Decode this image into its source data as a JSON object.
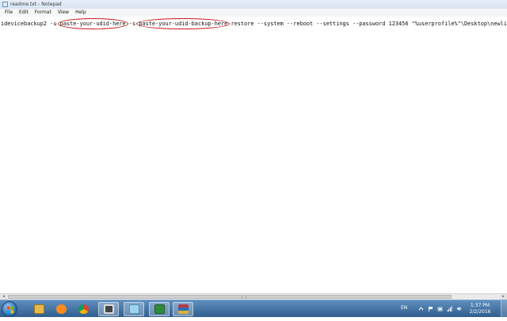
{
  "window": {
    "title": "readme.txt - Notepad"
  },
  "menu": {
    "items": [
      "File",
      "Edit",
      "Format",
      "View",
      "Help"
    ]
  },
  "editor": {
    "seg1": "idevicebackup2 -u ",
    "udid_placeholder": "paste-your-udid-here",
    "seg2": " -s ",
    "backup_placeholder": "paste-your-udid-backup-here",
    "seg3": " restore --system --reboot --settings --password 123456 \"%userprofile%\"\\Desktop\\newlibim"
  },
  "annotation_color": "#c4161c",
  "taskbar": {
    "language": "EN",
    "time": "1:37 PM",
    "date": "2/2/2016",
    "pinned": [
      {
        "name": "explorer-icon",
        "color": "#e8b84a"
      },
      {
        "name": "media-player-icon",
        "color": "#ff8a1c"
      },
      {
        "name": "chrome-icon",
        "color": "#4caf50"
      },
      {
        "name": "camera-icon",
        "color": "#444444"
      },
      {
        "name": "notepad-icon",
        "color": "#9fd3f0"
      },
      {
        "name": "spreadsheet-icon",
        "color": "#2e8b3a"
      },
      {
        "name": "archive-icon",
        "color": "#b23a48"
      }
    ]
  }
}
